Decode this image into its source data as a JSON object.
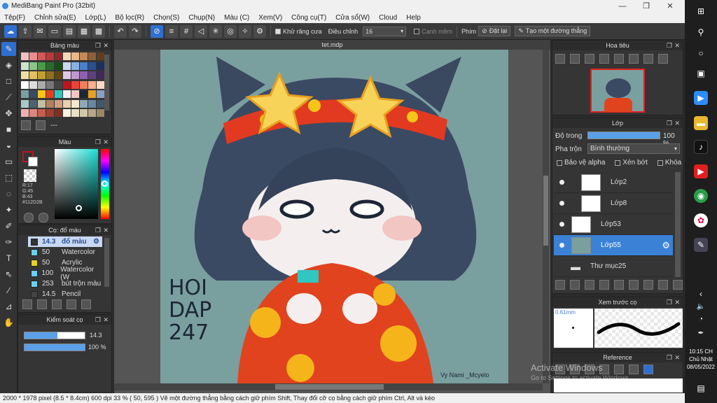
{
  "window": {
    "title": "MediBang Paint Pro (32bit)",
    "minimize": "—",
    "maximize": "❐",
    "close": "✕"
  },
  "menu": [
    "Tệp(F)",
    "Chỉnh sửa(E)",
    "Lớp(L)",
    "Bộ lọc(R)",
    "Chọn(S)",
    "Chụp(N)",
    "Màu (C)",
    "Xem(V)",
    "Công cụ(T)",
    "Cửa sổ(W)",
    "Cloud",
    "Help"
  ],
  "toolbar": {
    "antialias_label": "Khử răng cưa",
    "adjust_label": "Điều chỉnh",
    "adjust_value": "16",
    "edge_snap_label": "Cạnh mềm",
    "key_label": "Phím",
    "reset_label": "Đặt lại",
    "straight_line_label": "Tạo một đường thẳng"
  },
  "palette_panel": {
    "title": "Bảng màu",
    "footer_text": "---"
  },
  "color_panel": {
    "title": "Màu",
    "r": "R:17",
    "g": "G:45",
    "b": "B:43",
    "hex": "#112D2B",
    "primary_color": "#c0141c",
    "secondary_color": "#ffffff"
  },
  "brush_panel": {
    "title": "Cọ: đổ màu",
    "items": [
      {
        "size": "14.3",
        "name": "đổ màu",
        "color": "#333333",
        "selected": true
      },
      {
        "size": "50",
        "name": "Watercolor",
        "color": "#6ad0f0",
        "selected": false
      },
      {
        "size": "50",
        "name": "Acrylic",
        "color": "#e8d020",
        "selected": false
      },
      {
        "size": "100",
        "name": "Watercolor (W",
        "color": "#6ad0f0",
        "selected": false
      },
      {
        "size": "253",
        "name": "bút trộn màu",
        "color": "#6ad0f0",
        "selected": false
      },
      {
        "size": "14.5",
        "name": "Pencil",
        "color": "#444444",
        "selected": false
      }
    ]
  },
  "brush_control": {
    "title": "Kiểm soát cọ",
    "size": "14.3",
    "size_fill": 0.55,
    "opacity": "100 %",
    "opacity_fill": 1.0
  },
  "canvas": {
    "tab": "tet.mdp",
    "art_text": "HOI\nDAP\n247",
    "signature": "Vy Nami _Mcyelo"
  },
  "navigator": {
    "title": "Hoa tiêu"
  },
  "layer_panel": {
    "title": "Lớp",
    "opacity_label": "Độ trong",
    "opacity_value": "100 %",
    "opacity_fill": 1.0,
    "blend_label": "Pha trộn",
    "blend_value": "Bình thường",
    "protect_alpha": "Bảo vệ alpha",
    "clipping": "Xén bớt",
    "lock": "Khóa",
    "layers": [
      {
        "name": "Lớp2",
        "indent": true,
        "selected": false,
        "folder": false
      },
      {
        "name": "Lớp8",
        "indent": true,
        "selected": false,
        "folder": false
      },
      {
        "name": "Lớp53",
        "indent": false,
        "selected": false,
        "folder": false
      },
      {
        "name": "Lớp55",
        "indent": false,
        "selected": true,
        "folder": false
      },
      {
        "name": "Thư mục25",
        "indent": false,
        "selected": false,
        "folder": true
      }
    ]
  },
  "brush_preview": {
    "title": "Xem trước cọ",
    "size": "0.61mm"
  },
  "reference": {
    "title": "Reference"
  },
  "watermark": {
    "line1": "Activate Windows",
    "line2": "Go to Settings to activate Windows."
  },
  "statusbar": {
    "text": "2000 * 1978 pixel   (8.5 * 8.4cm)   600 dpi   33 %   ( 50, 595 )   Vẽ một đường thẳng bằng cách giữ phím Shift, Thay đổi cỡ cọ bằng cách giữ phím Ctrl, Alt và kéo"
  },
  "taskbar": {
    "time": "10:15 CH",
    "day": "Chủ Nhật",
    "date": "08/05/2022"
  }
}
